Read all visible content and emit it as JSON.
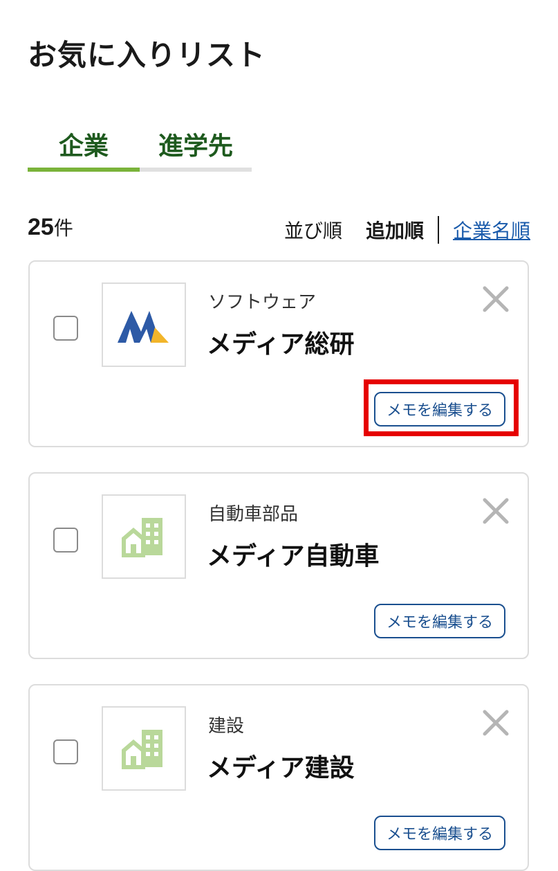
{
  "page_title": "お気に入りリスト",
  "tabs": [
    {
      "label": "企業",
      "active": true
    },
    {
      "label": "進学先",
      "active": false
    }
  ],
  "result": {
    "count": "25",
    "unit": "件"
  },
  "sort": {
    "label": "並び順",
    "active_option": "追加順",
    "other_option": "企業名順"
  },
  "colors": {
    "accent_green": "#7ab33a",
    "tab_text": "#1e5a1e",
    "link_blue": "#1a5bab",
    "highlight_red": "#e60000"
  },
  "cards": [
    {
      "category": "ソフトウェア",
      "name": "メディア総研",
      "memo_label": "メモを編集する",
      "logo": "media-souken-logo"
    },
    {
      "category": "自動車部品",
      "name": "メディア自動車",
      "memo_label": "メモを編集する",
      "logo": "building-placeholder-icon"
    },
    {
      "category": "建設",
      "name": "メディア建設",
      "memo_label": "メモを編集する",
      "logo": "building-placeholder-icon"
    }
  ]
}
